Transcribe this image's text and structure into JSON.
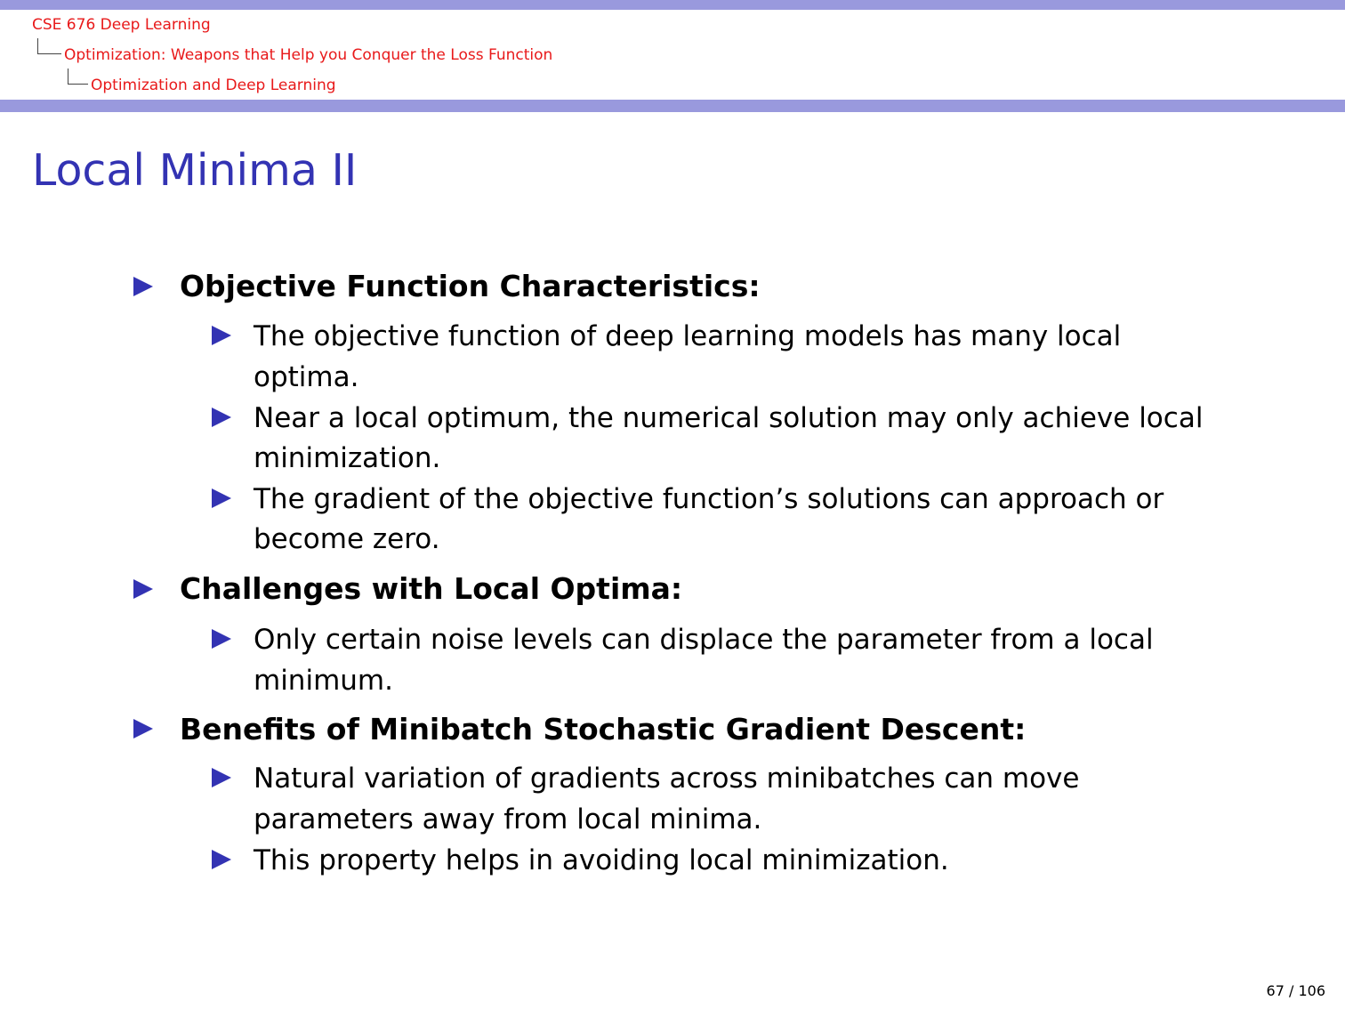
{
  "header": {
    "breadcrumb": [
      "CSE 676 Deep Learning",
      "Optimization: Weapons that Help you Conquer the Loss Function",
      "Optimization and Deep Learning"
    ]
  },
  "slide": {
    "title": "Local Minima II",
    "sections": [
      {
        "heading": "Objective Function Characteristics:",
        "items": [
          [
            "The objective function of deep learning models has many local",
            "optima."
          ],
          [
            "Near a local optimum, the numerical solution may only achieve local",
            "minimization."
          ],
          [
            "The gradient of the objective function’s solutions can approach or",
            "become zero."
          ]
        ]
      },
      {
        "heading": "Challenges with Local Optima:",
        "items": [
          [
            "Only certain noise levels can displace the parameter from a local",
            "minimum."
          ]
        ]
      },
      {
        "heading": "Benefits of Minibatch Stochastic Gradient Descent:",
        "items": [
          [
            "Natural variation of gradients across minibatches can move",
            "parameters away from local minima."
          ],
          [
            "This property helps in avoiding local minimization."
          ]
        ]
      }
    ]
  },
  "footer": {
    "page": "67 / 106"
  },
  "colors": {
    "accent": "#3333b3",
    "breadcrumb": "#e8191a",
    "band": "#9999dd"
  }
}
